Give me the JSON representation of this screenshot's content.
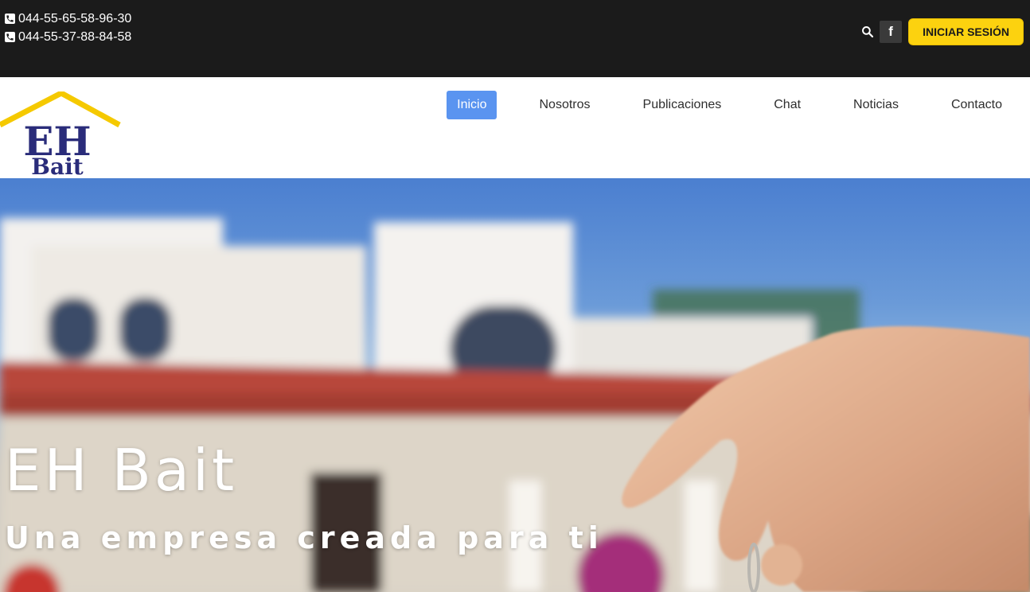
{
  "topbar": {
    "phones": [
      "044-55-65-58-96-30",
      "044-55-37-88-84-58"
    ],
    "social_icon": "f",
    "login_label": "INICIAR SESIÓN"
  },
  "brand": {
    "logo_line1": "EH",
    "logo_line2": "Bait",
    "logo_colors": {
      "roof": "#f5c900",
      "text": "#2a2c7a"
    }
  },
  "nav": {
    "items": [
      {
        "label": "Inicio",
        "active": true
      },
      {
        "label": "Nosotros"
      },
      {
        "label": "Publicaciones"
      },
      {
        "label": "Chat"
      },
      {
        "label": "Noticias"
      },
      {
        "label": "Contacto"
      }
    ],
    "active_color": "#5a94f0"
  },
  "hero": {
    "title": "EH Bait",
    "subtitle": "Una empresa creada para ti"
  },
  "colors": {
    "topbar_bg": "#1b1b1b",
    "login_bg": "#fcd20f"
  }
}
